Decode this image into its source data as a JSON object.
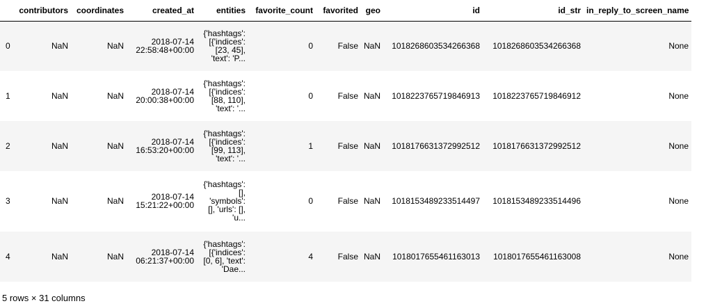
{
  "table": {
    "columns": [
      "",
      "contributors",
      "coordinates",
      "created_at",
      "entities",
      "favorite_count",
      "favorited",
      "geo",
      "id",
      "id_str",
      "in_reply_to_screen_name"
    ],
    "rows": [
      {
        "index": "0",
        "contributors": "NaN",
        "coordinates": "NaN",
        "created_at": [
          "2018-07-14",
          "22:58:48+00:00"
        ],
        "entities": [
          "{'hashtags':",
          "[{'indices':",
          "[23, 45],",
          "'text': 'P..."
        ],
        "favorite_count": "0",
        "favorited": "False",
        "geo": "NaN",
        "id": "1018268603534266368",
        "id_str": "1018268603534266368",
        "in_reply_to_screen_name": "None"
      },
      {
        "index": "1",
        "contributors": "NaN",
        "coordinates": "NaN",
        "created_at": [
          "2018-07-14",
          "20:00:38+00:00"
        ],
        "entities": [
          "{'hashtags':",
          "[{'indices':",
          "[88, 110],",
          "'text': '..."
        ],
        "favorite_count": "0",
        "favorited": "False",
        "geo": "NaN",
        "id": "1018223765719846913",
        "id_str": "1018223765719846912",
        "in_reply_to_screen_name": "None"
      },
      {
        "index": "2",
        "contributors": "NaN",
        "coordinates": "NaN",
        "created_at": [
          "2018-07-14",
          "16:53:20+00:00"
        ],
        "entities": [
          "{'hashtags':",
          "[{'indices':",
          "[99, 113],",
          "'text': '..."
        ],
        "favorite_count": "1",
        "favorited": "False",
        "geo": "NaN",
        "id": "1018176631372992512",
        "id_str": "1018176631372992512",
        "in_reply_to_screen_name": "None"
      },
      {
        "index": "3",
        "contributors": "NaN",
        "coordinates": "NaN",
        "created_at": [
          "2018-07-14",
          "15:21:22+00:00"
        ],
        "entities": [
          "{'hashtags':",
          "[],",
          "'symbols':",
          "[], 'urls': [],",
          "'u..."
        ],
        "favorite_count": "0",
        "favorited": "False",
        "geo": "NaN",
        "id": "1018153489233514497",
        "id_str": "1018153489233514496",
        "in_reply_to_screen_name": "None"
      },
      {
        "index": "4",
        "contributors": "NaN",
        "coordinates": "NaN",
        "created_at": [
          "2018-07-14",
          "06:21:37+00:00"
        ],
        "entities": [
          "{'hashtags':",
          "[{'indices':",
          "[0, 6], 'text':",
          "'Dae..."
        ],
        "favorite_count": "4",
        "favorited": "False",
        "geo": "NaN",
        "id": "1018017655461163013",
        "id_str": "1018017655461163008",
        "in_reply_to_screen_name": "None"
      }
    ]
  },
  "footer": {
    "shape_text": "5 rows × 31 columns"
  }
}
